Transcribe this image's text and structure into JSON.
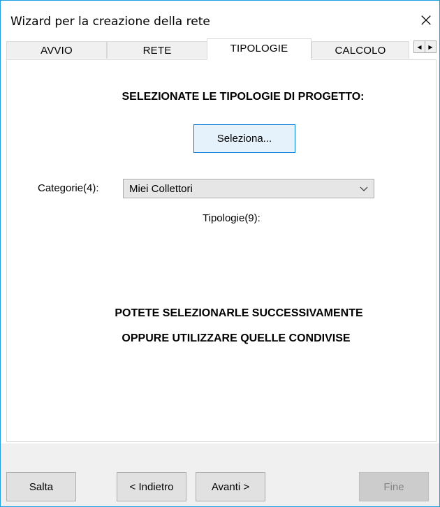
{
  "window": {
    "title": "Wizard per la creazione della rete",
    "close_glyph": "×"
  },
  "tabs": [
    {
      "label": "AVVIO",
      "active": false
    },
    {
      "label": "RETE",
      "active": false
    },
    {
      "label": "TIPOLOGIE",
      "active": true
    },
    {
      "label": "CALCOLO",
      "active": false
    }
  ],
  "tab_scroll": {
    "left_glyph": "◀",
    "right_glyph": "▶"
  },
  "main": {
    "heading": "SELEZIONATE LE TIPOLOGIE DI PROGETTO:",
    "select_button_label": "Seleziona...",
    "categories_label": "Categorie(4):",
    "categories_value": "Miei Collettori",
    "tipologie_label": "Tipologie(9):",
    "info_line_1": "POTETE SELEZIONARLE SUCCESSIVAMENTE",
    "info_line_2": "OPPURE UTILIZZARE QUELLE CONDIVISE"
  },
  "footer": {
    "skip_label": "Salta",
    "back_label": "< Indietro",
    "next_label": "Avanti >",
    "finish_label": "Fine",
    "finish_enabled": false
  },
  "colors": {
    "accent_border": "#0078d7",
    "window_border": "#1ba1e2",
    "footer_bg": "#f0f0f0"
  }
}
